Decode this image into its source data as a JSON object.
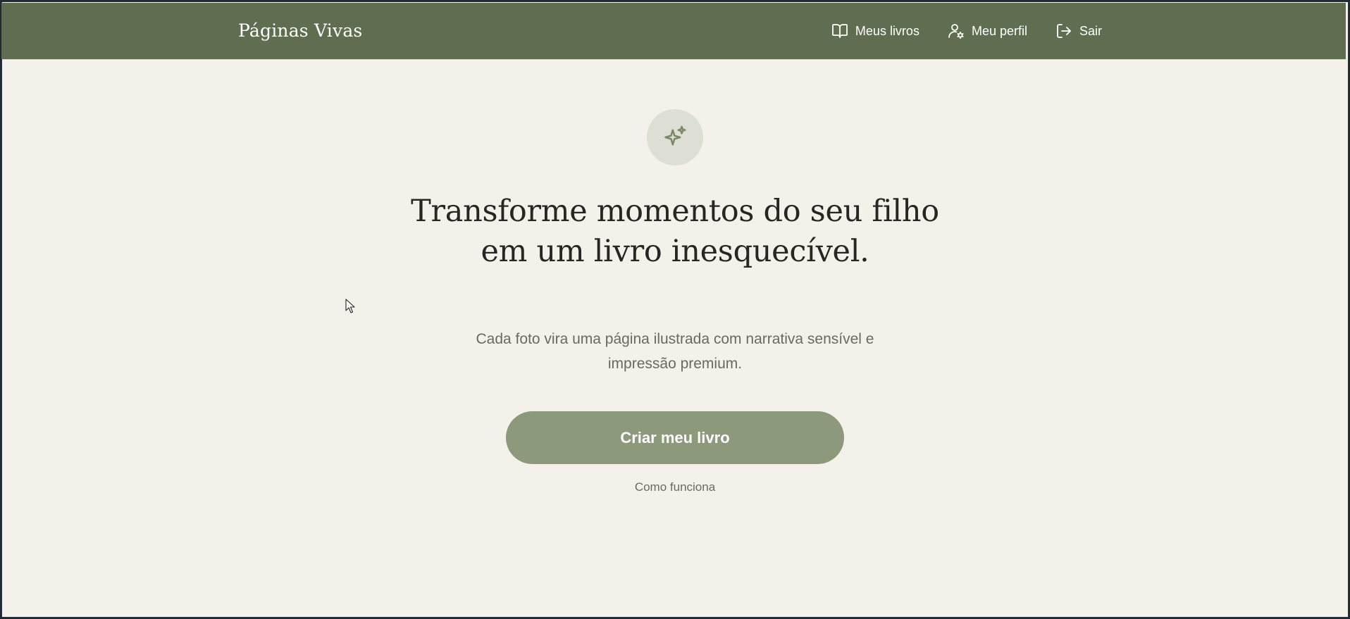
{
  "header": {
    "brand": "Páginas Vivas",
    "nav": [
      {
        "label": "Meus livros",
        "icon": "open-book-icon"
      },
      {
        "label": "Meu perfil",
        "icon": "user-settings-icon"
      },
      {
        "label": "Sair",
        "icon": "logout-icon"
      }
    ]
  },
  "hero": {
    "icon": "sparkles-icon",
    "headline": "Transforme momentos do seu filho em um livro inesquecível.",
    "subtitle": "Cada foto vira uma página ilustrada com narrativa sensível e impressão premium.",
    "cta_label": "Criar meu livro",
    "secondary_link": "Como funciona"
  },
  "colors": {
    "navbar": "#5f6e51",
    "background": "#f4f1eb",
    "accent_button": "#8d997b",
    "icon_circle": "#dedfd4"
  }
}
